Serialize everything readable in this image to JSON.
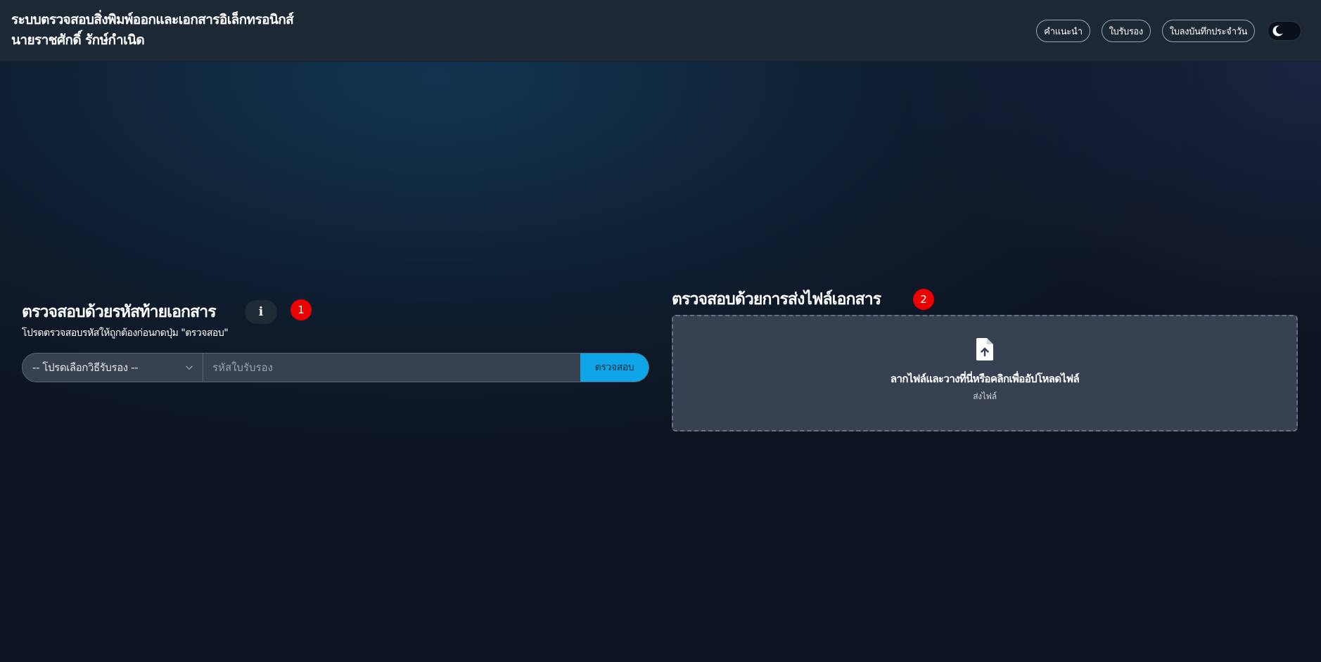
{
  "header": {
    "title_line1": "ระบบตรวจสอบสิ่งพิมพ์ออกและเอกสารอิเล็กทรอนิกส์",
    "title_line2": "นายราชศักดิ์ รักษ์กำเนิด",
    "nav": [
      {
        "label": "คำแนะนำ"
      },
      {
        "label": "ใบรับรอง"
      },
      {
        "label": "ใบลงบันทึกประจำวัน"
      }
    ],
    "theme_toggle_icon": "moon-icon"
  },
  "code_check": {
    "title": "ตรวจสอบด้วยรหัสท้ายเอกสาร",
    "info_icon": "i",
    "step_badge": "1",
    "subtitle": "โปรดตรวจสอบรหัสให้ถูกต้องก่อนกดปุ่ม \"ตรวจสอบ\"",
    "select_value": "-- โปรดเลือกวิธีรับรอง --",
    "input_placeholder": "รหัสใบรับรอง",
    "input_value": "",
    "submit_label": "ตรวจสอบ"
  },
  "file_check": {
    "title": "ตรวจสอบด้วยการส่งไฟล์เอกสาร",
    "step_badge": "2",
    "dropzone_text": "ลากไฟล์และวางที่นี่หรือคลิกเพื่ออัปโหลดไฟล์",
    "dropzone_subtext": "ส่งไฟล์",
    "icon": "file-upload-icon"
  },
  "colors": {
    "header_bg": "#1d2835",
    "accent": "#0ea5e9",
    "badge": "#ef0000",
    "field_bg": "#374151"
  }
}
